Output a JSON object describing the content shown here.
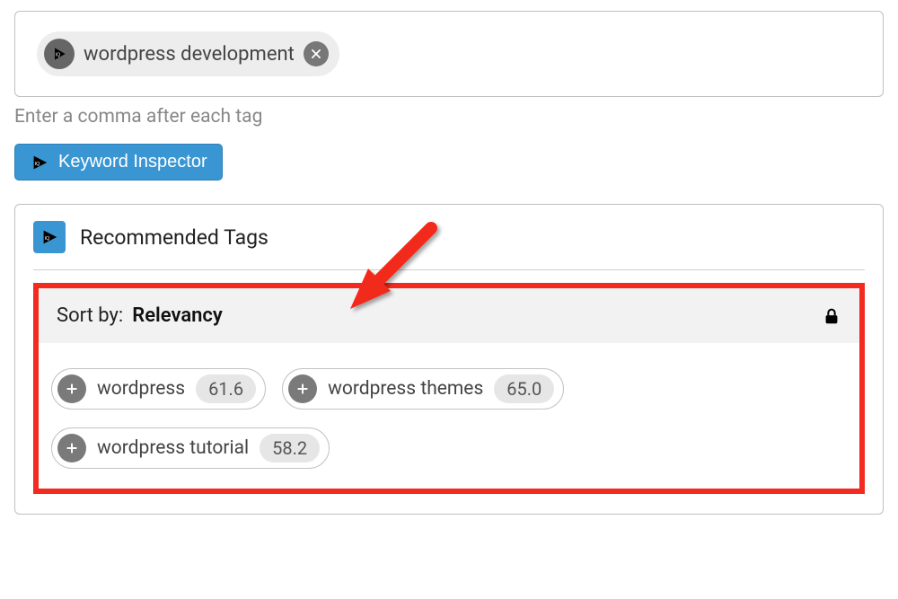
{
  "tag_input": {
    "current_tag": "wordpress development",
    "helper": "Enter a comma after each tag"
  },
  "inspector_button_label": "Keyword Inspector",
  "recommended": {
    "title": "Recommended Tags",
    "sort_label": "Sort by:",
    "sort_value": "Relevancy",
    "tags": [
      {
        "label": "wordpress",
        "score": "61.6"
      },
      {
        "label": "wordpress themes",
        "score": "65.0"
      },
      {
        "label": "wordpress tutorial",
        "score": "58.2"
      }
    ]
  },
  "icons": {
    "play": "play-icon",
    "close": "close-icon",
    "lock": "lock-icon",
    "plus": "plus-icon"
  },
  "colors": {
    "accent": "#3996d3",
    "highlight": "#f22a1f",
    "chip_bg": "#ededed"
  }
}
